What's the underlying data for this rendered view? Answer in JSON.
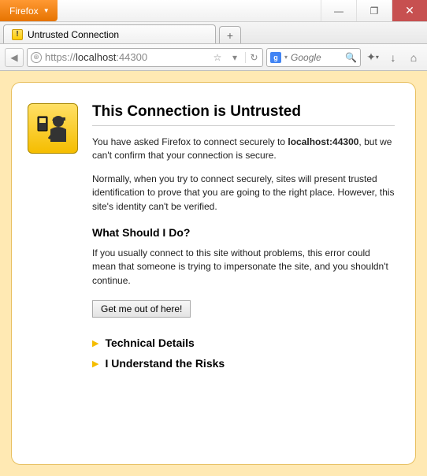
{
  "window": {
    "app_button": "Firefox",
    "minimize": "—",
    "maximize": "❐",
    "close": "✕"
  },
  "tab": {
    "title": "Untrusted Connection",
    "new_tab": "+"
  },
  "toolbar": {
    "back": "◀",
    "url_scheme": "https://",
    "url_host": "localhost",
    "url_port": ":44300",
    "star": "☆",
    "caret": "▾",
    "reload": "↻",
    "search_icon": "g",
    "search_placeholder": "Google",
    "magnifier": "🔍",
    "bookmark_menu": "✦",
    "downloads": "↓",
    "home": "⌂"
  },
  "page": {
    "heading": "This Connection is Untrusted",
    "p1a": "You have asked Firefox to connect securely to ",
    "p1_host": "localhost:44300",
    "p1b": ", but we can't confirm that your connection is secure.",
    "p2": "Normally, when you try to connect securely, sites will present trusted identification to prove that you are going to the right place. However, this site's identity can't be verified.",
    "h2": "What Should I Do?",
    "p3": "If you usually connect to this site without problems, this error could mean that someone is trying to impersonate the site, and you shouldn't continue.",
    "button": "Get me out of here!",
    "exp1": "Technical Details",
    "exp2": "I Understand the Risks"
  }
}
